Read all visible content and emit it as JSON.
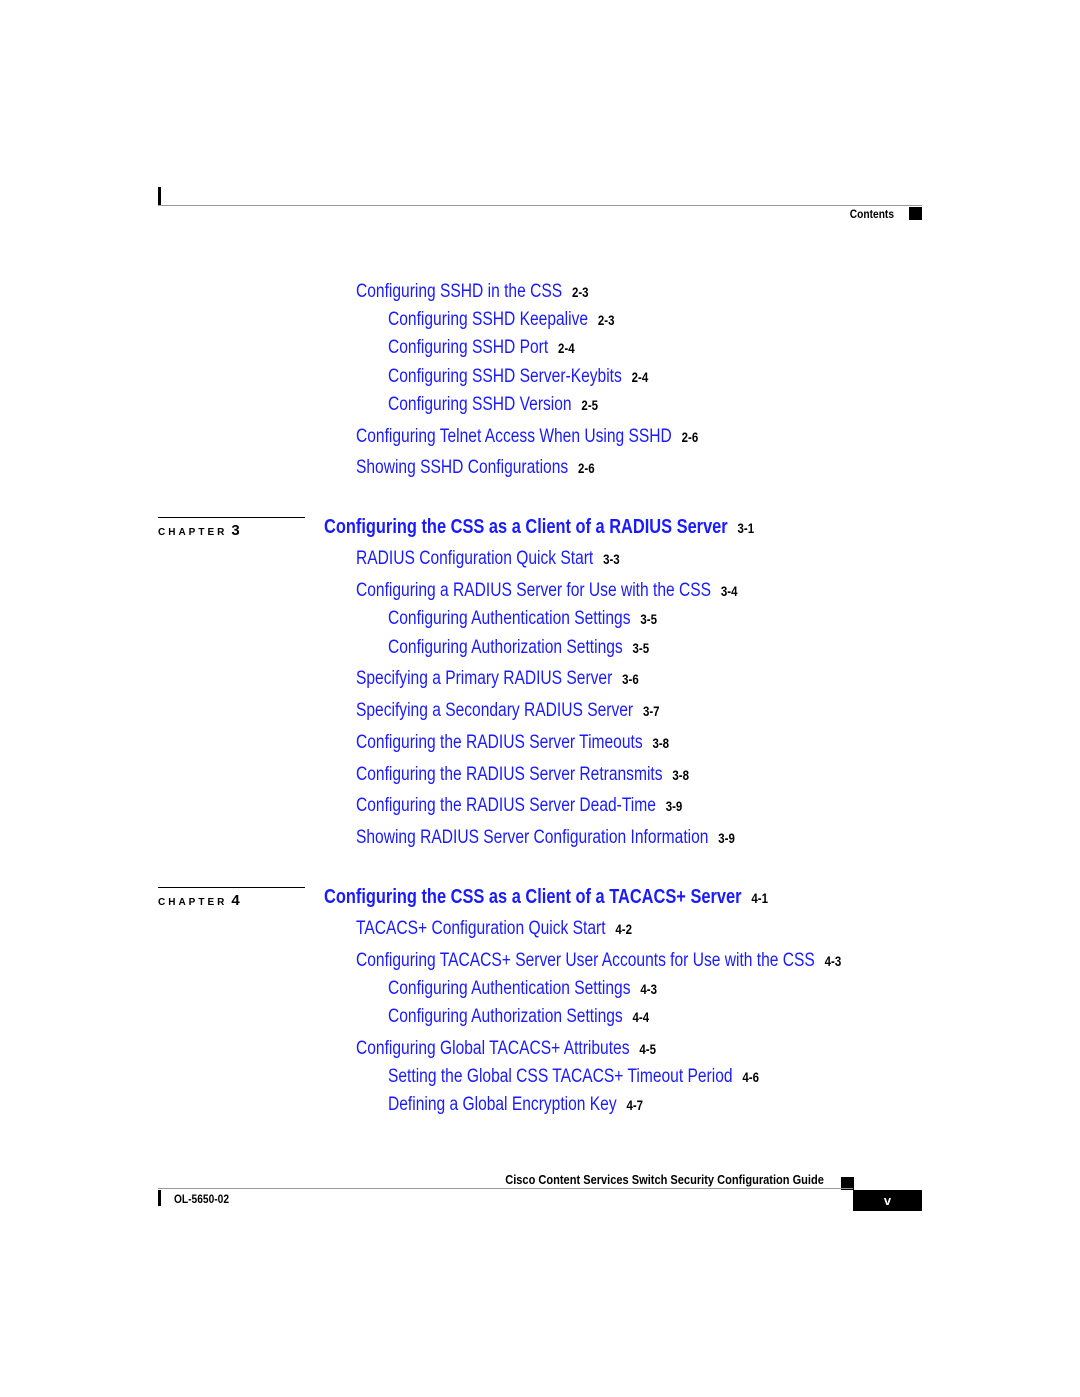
{
  "header": {
    "section_label": "Contents"
  },
  "toc_top": [
    {
      "level": 1,
      "title": "Configuring SSHD in the CSS",
      "page": "2-3"
    },
    {
      "level": 2,
      "title": "Configuring SSHD Keepalive",
      "page": "2-3"
    },
    {
      "level": 2,
      "title": "Configuring SSHD Port",
      "page": "2-4"
    },
    {
      "level": 2,
      "title": "Configuring SSHD Server-Keybits",
      "page": "2-4"
    },
    {
      "level": 2,
      "title": "Configuring SSHD Version",
      "page": "2-5"
    },
    {
      "level": 1,
      "title": "Configuring Telnet Access When Using SSHD",
      "page": "2-6"
    },
    {
      "level": 1,
      "title": "Showing SSHD Configurations",
      "page": "2-6"
    }
  ],
  "chapters": [
    {
      "label": "CHAPTER",
      "number": "3",
      "title": "Configuring the CSS as a Client of a RADIUS Server",
      "page": "3-1",
      "entries": [
        {
          "level": 1,
          "title": "RADIUS Configuration Quick Start",
          "page": "3-3"
        },
        {
          "level": 1,
          "title": "Configuring a RADIUS Server for Use with the CSS",
          "page": "3-4"
        },
        {
          "level": 2,
          "title": "Configuring Authentication Settings",
          "page": "3-5"
        },
        {
          "level": 2,
          "title": "Configuring Authorization Settings",
          "page": "3-5"
        },
        {
          "level": 1,
          "title": "Specifying a Primary RADIUS Server",
          "page": "3-6"
        },
        {
          "level": 1,
          "title": "Specifying a Secondary RADIUS Server",
          "page": "3-7"
        },
        {
          "level": 1,
          "title": "Configuring the RADIUS Server Timeouts",
          "page": "3-8"
        },
        {
          "level": 1,
          "title": "Configuring the RADIUS Server Retransmits",
          "page": "3-8"
        },
        {
          "level": 1,
          "title": "Configuring the RADIUS Server Dead-Time",
          "page": "3-9"
        },
        {
          "level": 1,
          "title": "Showing RADIUS Server Configuration Information",
          "page": "3-9"
        }
      ]
    },
    {
      "label": "CHAPTER",
      "number": "4",
      "title": "Configuring the CSS as a Client of a TACACS+ Server",
      "page": "4-1",
      "entries": [
        {
          "level": 1,
          "title": "TACACS+ Configuration Quick Start",
          "page": "4-2"
        },
        {
          "level": 1,
          "title": "Configuring TACACS+ Server User Accounts for Use with the CSS",
          "page": "4-3"
        },
        {
          "level": 2,
          "title": "Configuring Authentication Settings",
          "page": "4-3"
        },
        {
          "level": 2,
          "title": "Configuring Authorization Settings",
          "page": "4-4"
        },
        {
          "level": 1,
          "title": "Configuring Global TACACS+ Attributes",
          "page": "4-5"
        },
        {
          "level": 2,
          "title": "Setting the Global CSS TACACS+ Timeout Period",
          "page": "4-6"
        },
        {
          "level": 2,
          "title": "Defining a Global Encryption Key",
          "page": "4-7"
        }
      ]
    }
  ],
  "footer": {
    "book_title": "Cisco Content Services Switch Security Configuration Guide",
    "doc_number": "OL-5650-02",
    "page_number": "v"
  }
}
